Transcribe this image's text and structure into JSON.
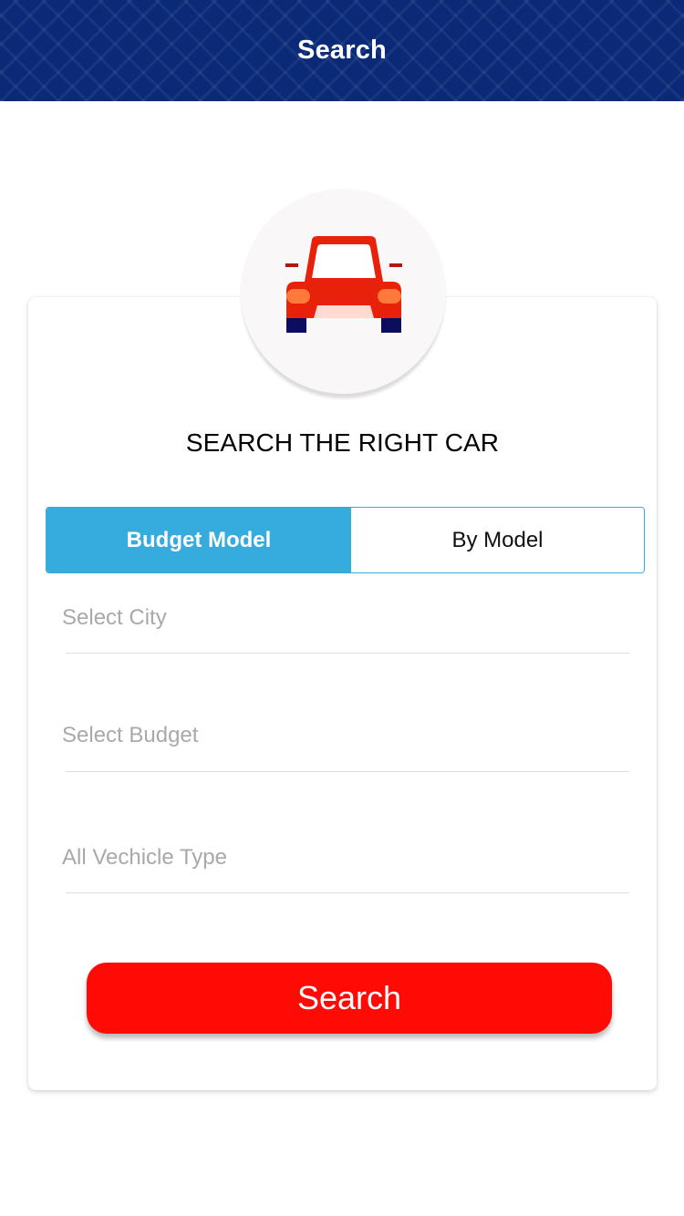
{
  "header": {
    "title": "Search"
  },
  "hero": {
    "icon": "car-front-icon"
  },
  "form": {
    "title": "SEARCH THE RIGHT CAR",
    "tabs": [
      {
        "label": "Budget Model",
        "selected": true
      },
      {
        "label": "By Model",
        "selected": false
      }
    ],
    "fields": [
      {
        "placeholder": "Select City"
      },
      {
        "placeholder": "Select Budget"
      },
      {
        "placeholder": "All Vechicle Type"
      }
    ],
    "search_label": "Search"
  },
  "colors": {
    "header_bg": "#0a2a78",
    "tab_active": "#35acdd",
    "search_button": "#ff0a05",
    "car_body": "#e8220a"
  }
}
